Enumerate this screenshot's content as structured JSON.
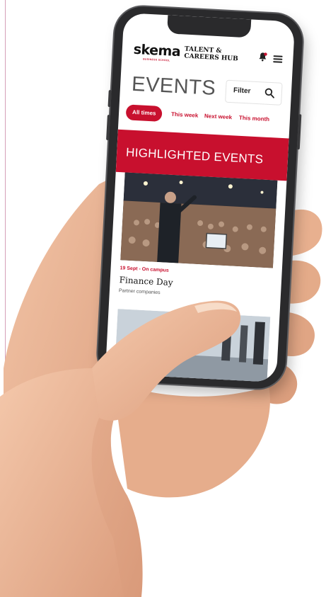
{
  "app": {
    "logo_text": "skema",
    "logo_subtext": "BUSINESS SCHOOL",
    "hub_line1": "TALENT &",
    "hub_line2": "CAREERS HUB"
  },
  "page": {
    "title": "EVENTS",
    "filter_label": "Filter"
  },
  "tabs": [
    {
      "label": "All times",
      "active": true
    },
    {
      "label": "This week",
      "active": false
    },
    {
      "label": "Next week",
      "active": false
    },
    {
      "label": "This month",
      "active": false
    }
  ],
  "highlighted": {
    "section_title": "HIGHLIGHTED EVENTS",
    "events": [
      {
        "date": "19 Sept - On campus",
        "name": "Finance Day",
        "category": "Partner companies"
      }
    ]
  },
  "colors": {
    "accent": "#c8102e",
    "text": "#111111",
    "muted": "#555555"
  },
  "icons": [
    "bell-icon",
    "menu-icon",
    "search-icon"
  ]
}
